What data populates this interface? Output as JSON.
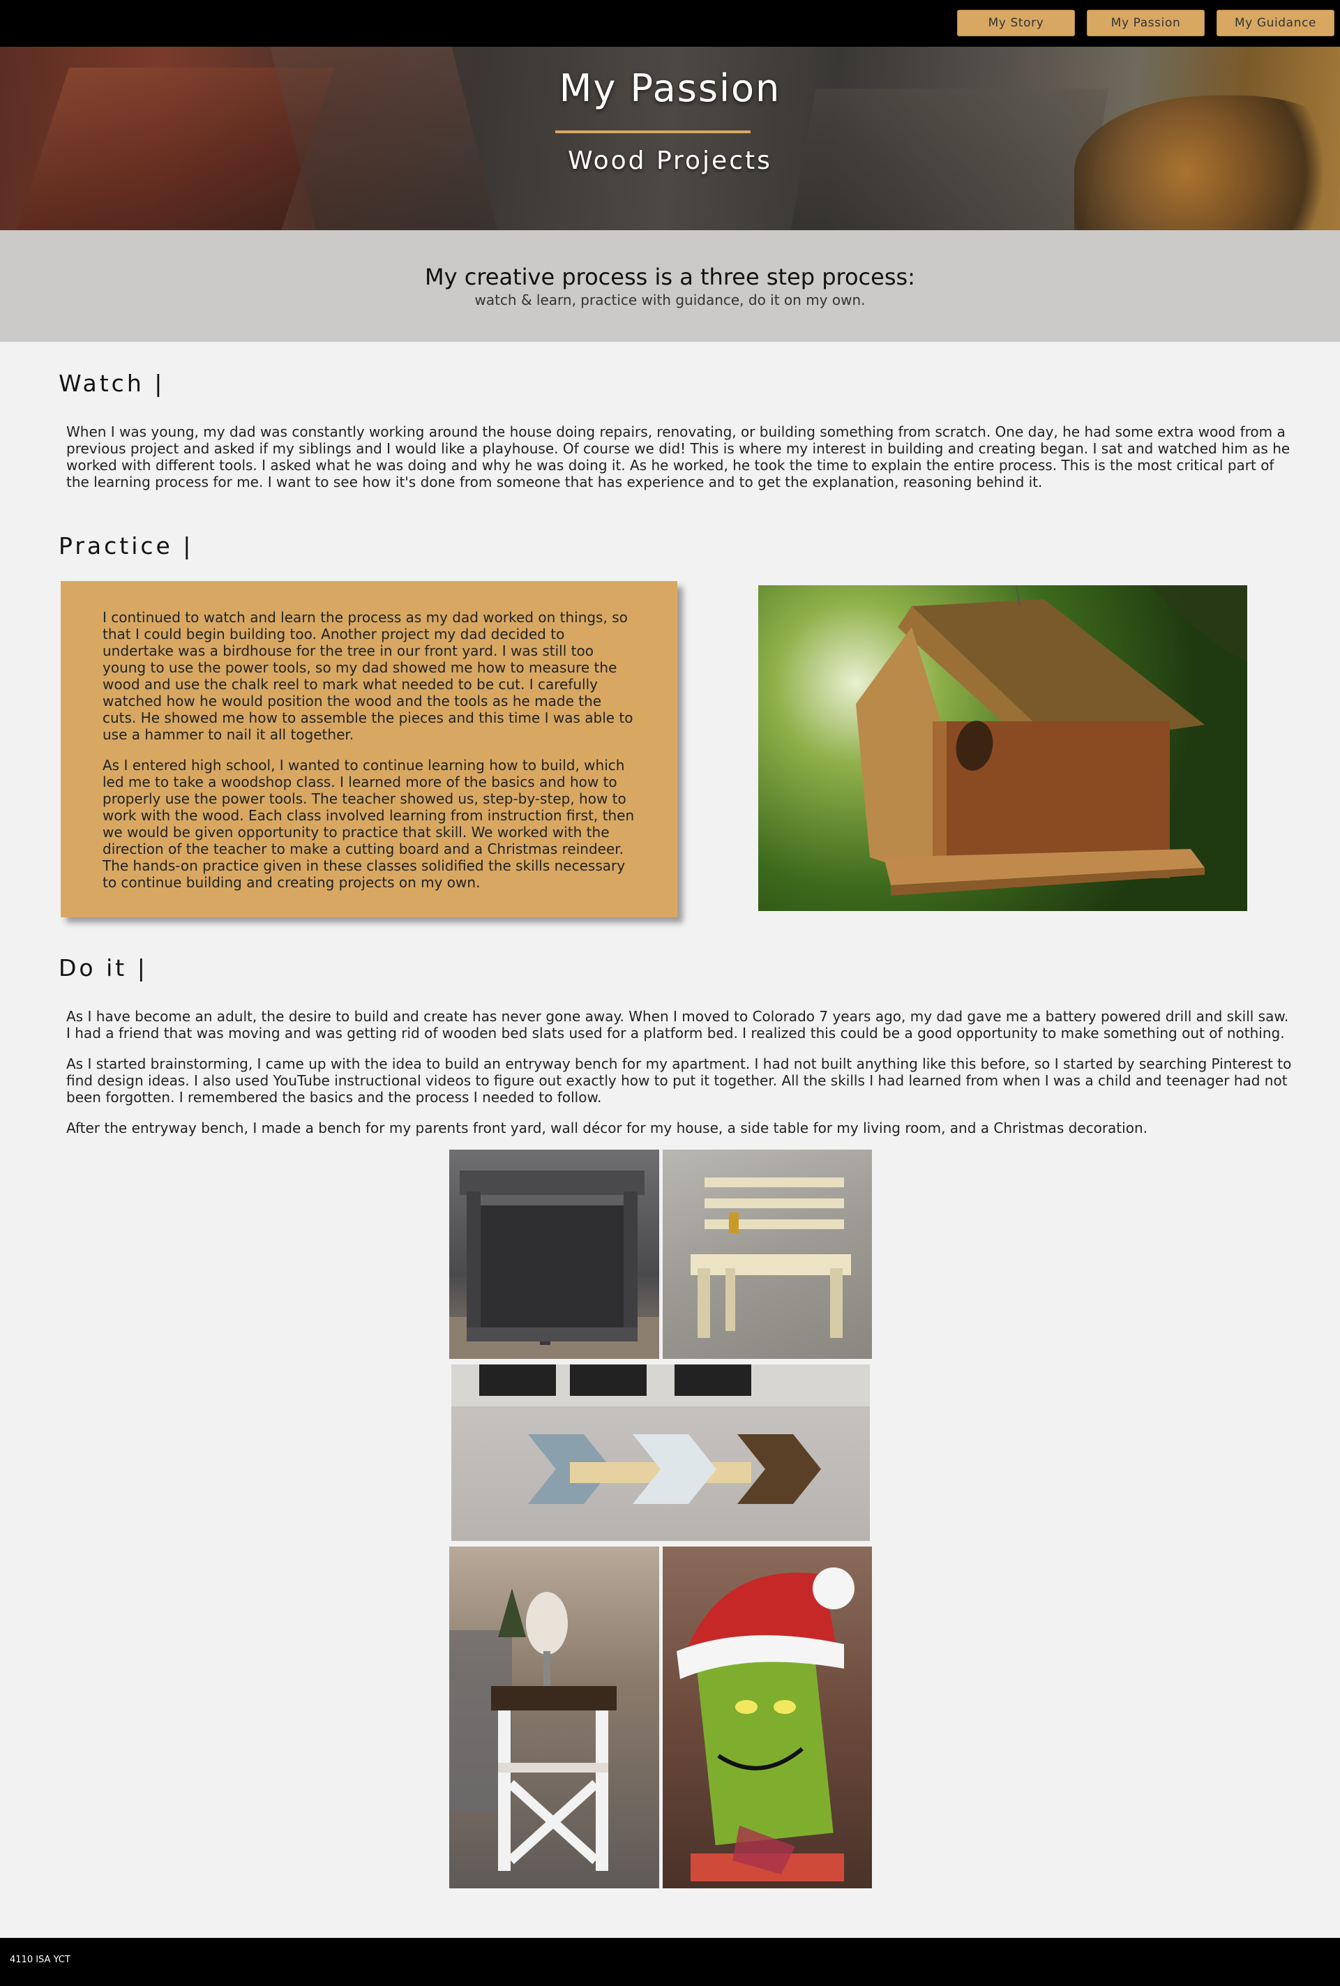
{
  "nav": {
    "items": [
      {
        "label": "My Story"
      },
      {
        "label": "My Passion"
      },
      {
        "label": "My Guidance"
      }
    ],
    "accent_color": "#d8a863"
  },
  "hero": {
    "title": "My Passion",
    "subtitle": "Wood Projects"
  },
  "intro": {
    "heading": "My creative process is a three step process:",
    "subheading": "watch & learn, practice with guidance, do it on my own."
  },
  "watch": {
    "heading": "Watch |",
    "text": "When I was young, my dad was constantly working around the house doing repairs, renovating, or building something from scratch. One day, he had some extra wood from a previous project and asked if my siblings and I would like a playhouse. Of course we did! This is where my interest in building and creating began. I sat and watched him as he worked with different tools. I asked what he was doing and why he was doing it. As he worked, he took the time to explain the entire process. This is the most critical part of the learning process for me. I want to see how it's done from someone that has experience and to get the explanation, reasoning behind it."
  },
  "practice": {
    "heading": "Practice |",
    "paragraphs": [
      "I continued to watch and learn the process as my dad worked on things, so that I could begin building too. Another project my dad decided to undertake was a birdhouse for the tree in our front yard. I was still too young to use the power tools, so my dad showed me how to measure the wood and use the chalk reel to mark what needed to be cut. I carefully watched how he would position the wood and the tools as he made the cuts. He showed me how to assemble the pieces and this time I was able to use a hammer to nail it all together.",
      "As I entered high school, I wanted to continue learning how to build, which led me to take a woodshop class. I learned more of the basics and how to properly use the power tools. The teacher showed us, step-by-step, how to work with the wood. Each class involved learning from instruction first, then we would be given opportunity to practice that skill. We worked with the direction of the teacher to make a cutting board and a Christmas reindeer. The hands-on practice given in these classes solidified the skills necessary to continue building and creating projects on my own."
    ]
  },
  "doit": {
    "heading": "Do it |",
    "paragraphs": [
      "As I have become an adult, the desire to build and create has never gone away. When I moved to Colorado 7 years ago, my dad gave me a battery powered drill and skill saw. I had a friend that was moving and was getting rid of wooden bed slats used for a platform bed. I realized this could be a good opportunity to make something out of nothing.",
      "As I started brainstorming, I came up with the idea to build an entryway bench for my apartment. I had not built anything like this before, so I started by searching Pinterest to find design ideas. I also used YouTube instructional videos to figure out exactly how to put it together. All the skills I had learned from when I was a child and teenager had not been forgotten. I remembered the basics and the process I needed to follow.",
      "After the entryway bench, I made a bench for my parents front yard, wall décor for my house, a side table for my living room, and a Christmas decoration."
    ]
  },
  "footer": {
    "text": "4110 ISA YCT"
  }
}
